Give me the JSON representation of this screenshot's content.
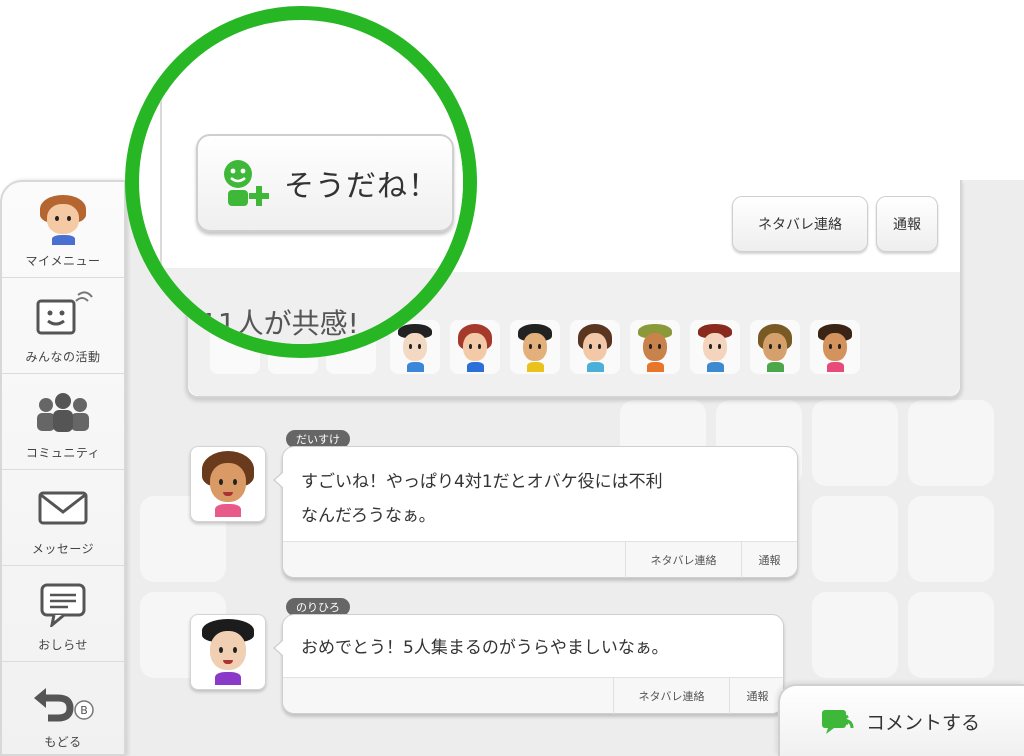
{
  "sidebar": {
    "items": [
      {
        "label": "マイメニュー",
        "icon": "mii-avatar-icon"
      },
      {
        "label": "みんなの活動",
        "icon": "activity-feed-icon"
      },
      {
        "label": "コミュニティ",
        "icon": "community-icon"
      },
      {
        "label": "メッセージ",
        "icon": "envelope-icon"
      },
      {
        "label": "おしらせ",
        "icon": "notification-icon"
      },
      {
        "label": "もどる",
        "icon": "back-arrow-icon",
        "badge": "B"
      }
    ]
  },
  "post": {
    "yeah_label": "そうだね！",
    "spoiler_label": "ネタバレ連絡",
    "report_label": "通報",
    "empathy_count_text": "11人が共感!"
  },
  "comments": [
    {
      "name": "だいすけ",
      "text_line1": "すごいね！やっぱり4対1だとオバケ役には不利",
      "text_line2": "なんだろうなぁ。",
      "spoiler_label": "ネタバレ連絡",
      "report_label": "通報"
    },
    {
      "name": "のりひろ",
      "text_line1": "おめでとう！5人集まるのがうらやましいなぁ。",
      "spoiler_label": "ネタバレ連絡",
      "report_label": "通報"
    }
  ],
  "footer": {
    "comment_button_label": "コメントする"
  },
  "colors": {
    "accent_green": "#27b624",
    "yeah_icon_green": "#3fb83a"
  }
}
